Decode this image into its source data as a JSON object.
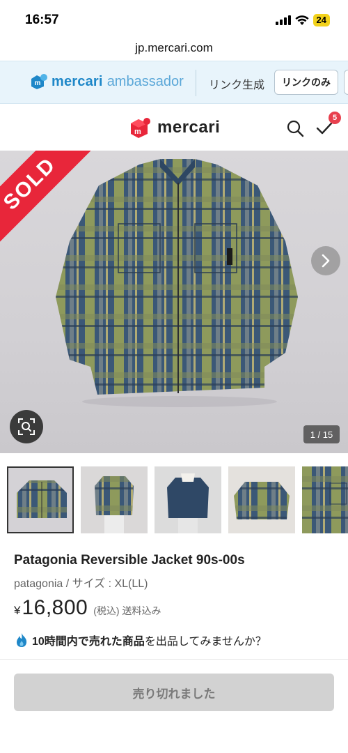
{
  "status_bar": {
    "time": "16:57",
    "battery": "24"
  },
  "browser": {
    "url": "jp.mercari.com"
  },
  "ambassador_bar": {
    "brand": "mercari",
    "sub": "ambassador",
    "link_generate": "リンク生成",
    "link_only": "リンクのみ"
  },
  "header": {
    "logo_text": "mercari",
    "notification_count": "5"
  },
  "gallery": {
    "sold_label": "SOLD",
    "counter": "1 / 15",
    "thumbnail_count": 5,
    "selected_index": 0
  },
  "product": {
    "title": "Patagonia Reversible Jacket 90s-00s",
    "brand_size": "patagonia / サイズ : XL(LL)",
    "price_symbol": "¥",
    "price": "16,800",
    "tax_shipping": "(税込) 送料込み"
  },
  "promo": {
    "bold_text": "10時間内で売れた商品",
    "rest_text": "を出品してみませんか？"
  },
  "sold_button": {
    "label": "売り切れました"
  },
  "colors": {
    "mercari_red": "#e8263a",
    "ambassador_blue": "#1e87c8",
    "sold_button_bg": "#d2d2d2"
  }
}
